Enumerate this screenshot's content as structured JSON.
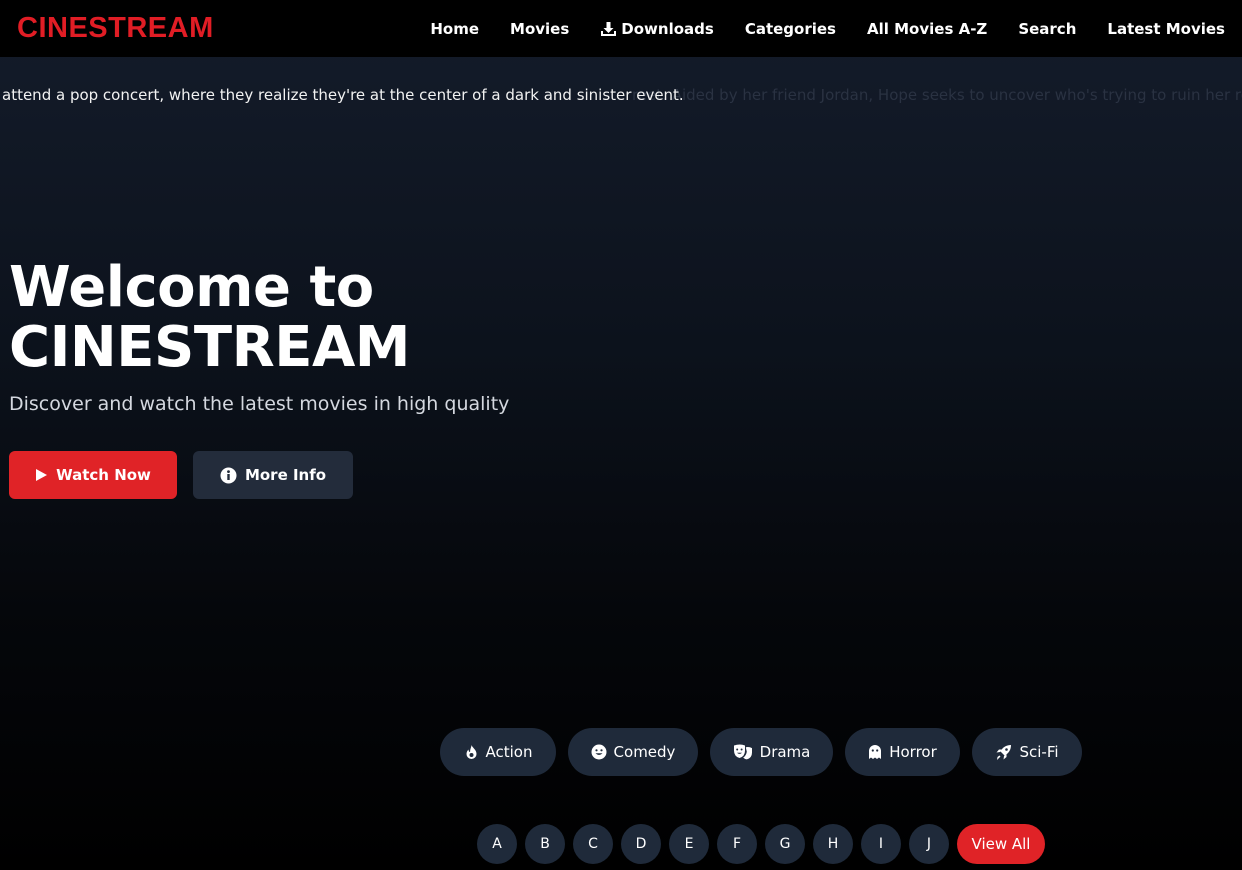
{
  "brand": {
    "name": "CINESTREAM",
    "color": "#e11d25"
  },
  "nav": {
    "items": [
      {
        "label": "Home",
        "icon": ""
      },
      {
        "label": "Movies",
        "icon": ""
      },
      {
        "label": "Downloads",
        "icon": "download-icon"
      },
      {
        "label": "Categories",
        "icon": ""
      },
      {
        "label": "All Movies A-Z",
        "icon": ""
      },
      {
        "label": "Search",
        "icon": ""
      },
      {
        "label": "Latest Movies",
        "icon": ""
      }
    ]
  },
  "marquee": {
    "bright_text": "attend a pop concert, where they realize they're at the center of a dark and sinister event.",
    "faded_text": "reet. Aided by her friend Jordan, Hope seeks to uncover who's trying to ruin her reputation"
  },
  "hero": {
    "title": "Welcome to CINESTREAM",
    "subtitle": "Discover and watch the latest movies in high quality",
    "watch_now": {
      "label": "Watch Now",
      "icon": "play-icon"
    },
    "more_info": {
      "label": "More Info",
      "icon": "info-icon"
    }
  },
  "genres": [
    {
      "label": "Action",
      "icon": "fire-icon"
    },
    {
      "label": "Comedy",
      "icon": "smile-icon"
    },
    {
      "label": "Drama",
      "icon": "masks-icon"
    },
    {
      "label": "Horror",
      "icon": "ghost-icon"
    },
    {
      "label": "Sci-Fi",
      "icon": "rocket-icon"
    }
  ],
  "alphabet": {
    "letters": [
      "A",
      "B",
      "C",
      "D",
      "E",
      "F",
      "G",
      "H",
      "I",
      "J"
    ],
    "view_all": "View All"
  },
  "colors": {
    "accent": "#e02327",
    "pill_bg": "#1f2a3a",
    "secondary_button": "#232c3b"
  }
}
